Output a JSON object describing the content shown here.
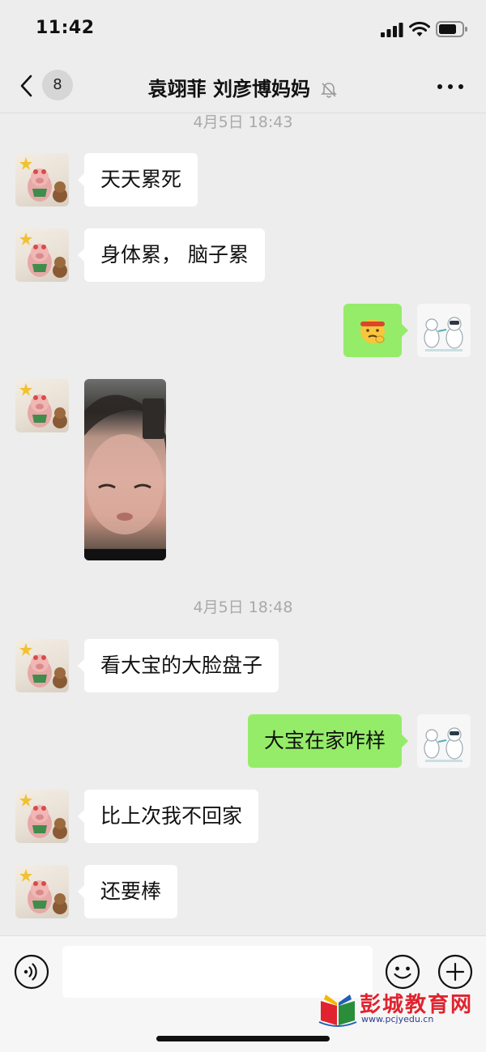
{
  "status_bar": {
    "time": "11:42"
  },
  "nav": {
    "unread_count": "8",
    "title": "袁翊菲 刘彦博妈妈"
  },
  "messages": [
    {
      "kind": "timestamp",
      "text": "4月5日 18:43"
    },
    {
      "kind": "text",
      "side": "incoming",
      "text": "天天累死"
    },
    {
      "kind": "text",
      "side": "incoming",
      "text": "身体累， 脑子累"
    },
    {
      "kind": "emoji",
      "side": "outgoing",
      "content": "thinking-face-emoji"
    },
    {
      "kind": "image",
      "side": "incoming",
      "content": "child-selfie-photo"
    },
    {
      "kind": "timestamp",
      "text": "4月5日 18:48"
    },
    {
      "kind": "text",
      "side": "incoming",
      "text": "看大宝的大脸盘子"
    },
    {
      "kind": "text",
      "side": "outgoing",
      "text": "大宝在家咋样"
    },
    {
      "kind": "text",
      "side": "incoming",
      "text": "比上次我不回家"
    },
    {
      "kind": "text",
      "side": "incoming",
      "text": "还要棒"
    }
  ],
  "input_bar": {
    "voice_icon": "voice-icon",
    "emoji_icon": "smiley-icon",
    "plus_icon": "plus-icon",
    "input_value": ""
  },
  "watermark": {
    "name": "彭城教育网",
    "url": "www.pcjyedu.cn"
  },
  "colors": {
    "background": "#ededed",
    "outgoing_bubble": "#95ec69",
    "incoming_bubble": "#ffffff",
    "timestamp_text": "#a9a9a9",
    "watermark_red": "#e0232e"
  }
}
